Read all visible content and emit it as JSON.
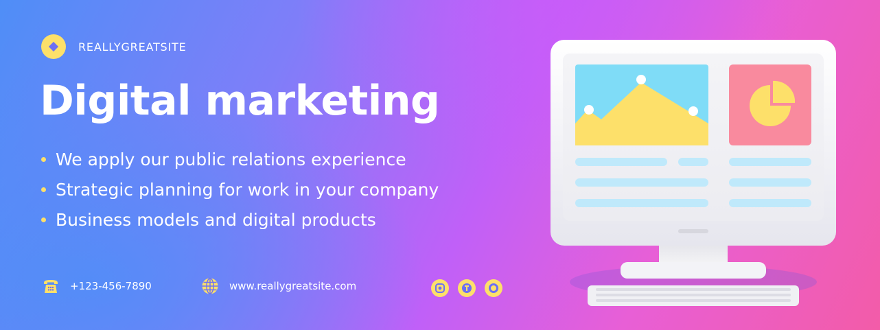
{
  "brand": {
    "name": "REALLYGREATSITE",
    "logo_icon": "diamond-logo-icon"
  },
  "headline": "Digital marketing",
  "bullets": [
    "We apply our public relations experience",
    "Strategic planning for work in your company",
    "Business models and digital products"
  ],
  "contact": {
    "phone": "+123-456-7890",
    "phone_icon": "telephone-icon",
    "website": "www.reallygreatsite.com",
    "website_icon": "globe-icon"
  },
  "socials": [
    "instagram-icon",
    "twitter-icon",
    "circle-social-icon"
  ],
  "colors": {
    "accent": "#fde06a",
    "gradient_start": "#4f8ef7",
    "gradient_mid": "#c060f8",
    "gradient_end": "#f35ca8"
  }
}
